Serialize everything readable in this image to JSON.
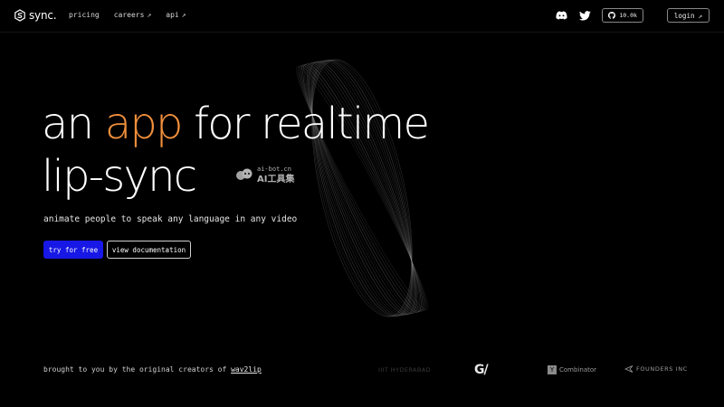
{
  "nav": {
    "brand": "sync.",
    "links": [
      {
        "label": "pricing",
        "external": ""
      },
      {
        "label": "careers",
        "external": "↗"
      },
      {
        "label": "api",
        "external": "↗"
      }
    ],
    "github_stars": "10.0k",
    "login_label": "login",
    "login_arrow": "↗",
    "icons": [
      "discord-icon",
      "twitter-icon",
      "github-icon"
    ]
  },
  "hero": {
    "title_part1": "an ",
    "title_accent": "app",
    "title_part2": " for realtime",
    "title_line2": "lip-sync",
    "subtitle": "animate people to speak any language in any video",
    "primary_button": "try for free",
    "secondary_button": "view documentation",
    "accent_color": "#f18f3b",
    "primary_color": "#1717e6"
  },
  "watermark": {
    "top": "ai-bot.cn",
    "bottom": "AI工具集"
  },
  "footer": {
    "credits_text": "brought to you by the original creators of ",
    "credits_link": "wav2lip",
    "logos": {
      "iiit": "IIIT HYDERABAD",
      "gv": "G/",
      "yc_mark": "Y",
      "yc": "Combinator",
      "founders": "FOUNDERS INC"
    }
  }
}
